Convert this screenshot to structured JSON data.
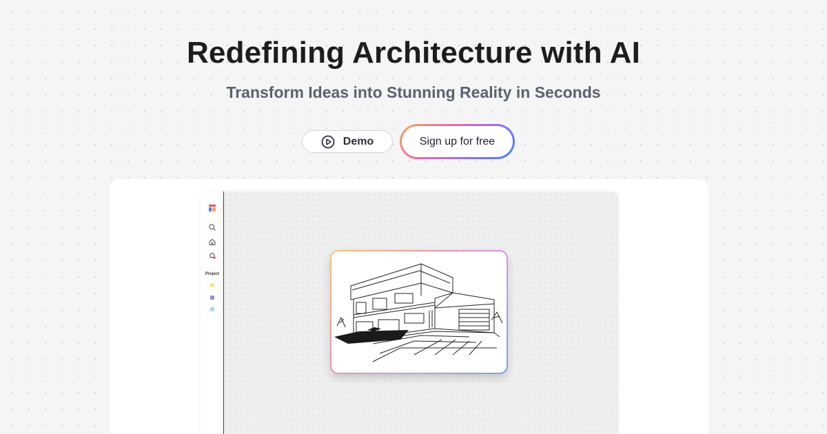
{
  "hero": {
    "title": "Redefining Architecture with AI",
    "subtitle": "Transform Ideas into Stunning Reality in Seconds"
  },
  "actions": {
    "demo_label": "Demo",
    "demo_icon": "play-circle-icon",
    "signup_label": "Sign up for free"
  },
  "app_preview": {
    "sidebar": {
      "logo_icon": "app-logo-icon",
      "nav_icons": [
        "search-icon",
        "home-icon",
        "notification-icon"
      ],
      "section_label": "Project",
      "project_colors": [
        "#f5e58c",
        "#8e92d6",
        "#a9dcec"
      ]
    },
    "render_image": "architectural-sketch-house"
  },
  "colors": {
    "page_background": "#f5f5f5",
    "title": "#1d1d1f",
    "subtitle": "#5b6170",
    "signup_gradient": [
      "#f6a35a",
      "#ec6aa0",
      "#9b6cf0",
      "#3b82f6"
    ]
  }
}
